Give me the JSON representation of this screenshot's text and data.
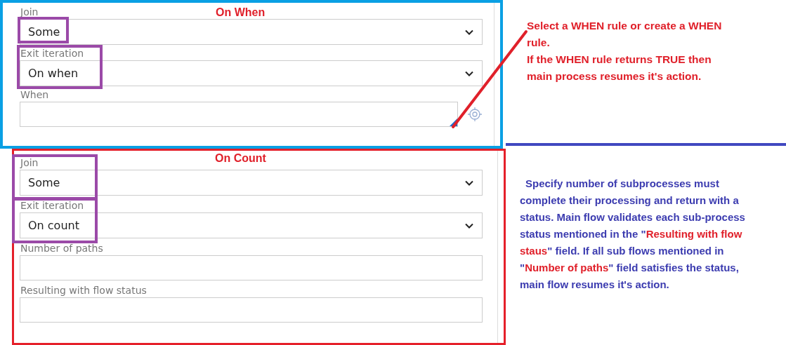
{
  "sections": [
    {
      "title": "On When",
      "kind": "when",
      "fields": [
        {
          "label": "Join",
          "kind": "select",
          "value": "Some",
          "value_highlighted": true,
          "field_highlighted": false
        },
        {
          "label": "Exit iteration",
          "kind": "select",
          "value": "On when",
          "value_highlighted": false,
          "field_highlighted": true
        },
        {
          "label": "When",
          "kind": "rule",
          "value_highlighted": false,
          "field_highlighted": false
        }
      ],
      "note": {
        "kind": "plain",
        "lines": [
          "Select a WHEN rule or create a WHEN rule.",
          "If the WHEN rule returns TRUE then main process resumes it's action."
        ]
      }
    },
    {
      "title": "On Count",
      "kind": "count",
      "fields": [
        {
          "label": "Join",
          "kind": "select",
          "value": "Some",
          "value_highlighted": false,
          "field_highlighted": true
        },
        {
          "label": "Exit iteration",
          "kind": "select",
          "value": "On count",
          "value_highlighted": false,
          "field_highlighted": true
        },
        {
          "label": "Number of paths",
          "kind": "text",
          "value_highlighted": false,
          "field_highlighted": false
        },
        {
          "label": "Resulting with flow status",
          "kind": "text",
          "value_highlighted": false,
          "field_highlighted": false
        }
      ],
      "note": {
        "kind": "segments",
        "segments": [
          {
            "text": "Specify number of subprocesses must complete their processing and return with a status. Main flow validates each sub-process status mentioned in the \"",
            "emphasis": false
          },
          {
            "text": "Resulting with flow staus",
            "emphasis": true
          },
          {
            "text": "\" field. If all sub flows mentioned in \"",
            "emphasis": false
          },
          {
            "text": "Number of paths",
            "emphasis": true
          },
          {
            "text": "\" field satisfies the status, main flow resumes it's action.",
            "emphasis": false
          }
        ]
      }
    }
  ]
}
